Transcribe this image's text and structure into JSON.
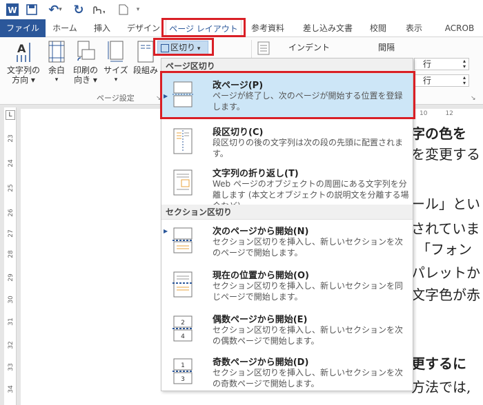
{
  "qat": {
    "app_icon": "W",
    "undo_label": "↶",
    "redo_label": "↻"
  },
  "tabs": [
    {
      "label": "ファイル"
    },
    {
      "label": "ホーム"
    },
    {
      "label": "挿入"
    },
    {
      "label": "デザイン"
    },
    {
      "label": "ページ レイアウト"
    },
    {
      "label": "参考資料"
    },
    {
      "label": "差し込み文書"
    },
    {
      "label": "校閲"
    },
    {
      "label": "表示"
    },
    {
      "label": "ACROB"
    }
  ],
  "ribbon": {
    "text_direction": {
      "line1": "文字列の",
      "line2": "方向"
    },
    "margins": {
      "line1": "余白"
    },
    "orientation": {
      "line1": "印刷の",
      "line2": "向き"
    },
    "size": {
      "line1": "サイズ"
    },
    "columns": {
      "line1": "段組み"
    },
    "breaks": {
      "label": "区切り"
    },
    "indent": {
      "label": "インデント"
    },
    "spacing": {
      "label": "間隔"
    },
    "spacing_before": {
      "unit": "行"
    },
    "spacing_after": {
      "unit": "行"
    },
    "group_page_setup": "ページ設定",
    "hruler_marks": [
      "10",
      "12"
    ]
  },
  "menu": {
    "section_page": "ページ区切り",
    "section_section": "セクション区切り",
    "items": [
      {
        "title": "改ページ(P)",
        "desc": "ページが終了し、次のページが開始する位置を登録します。"
      },
      {
        "title": "段区切り(C)",
        "desc": "段区切りの後の文字列は次の段の先頭に配置されます。"
      },
      {
        "title": "文字列の折り返し(T)",
        "desc": "Web ページのオブジェクトの周囲にある文字列を分離します (本文とオブジェクトの説明文を分離する場合など)。"
      },
      {
        "title": "次のページから開始(N)",
        "desc": "セクション区切りを挿入し、新しいセクションを次のページで開始します。"
      },
      {
        "title": "現在の位置から開始(O)",
        "desc": "セクション区切りを挿入し、新しいセクションを同じページで開始します。"
      },
      {
        "title": "偶数ページから開始(E)",
        "desc": "セクション区切りを挿入し、新しいセクションを次の偶数ページで開始します。"
      },
      {
        "title": "奇数ページから開始(D)",
        "desc": "セクション区切りを挿入し、新しいセクションを次の奇数ページで開始します。"
      }
    ]
  },
  "ruler": {
    "marker": "L",
    "numbers": [
      "23",
      "24",
      "25",
      "26",
      "27",
      "28",
      "29",
      "30",
      "31",
      "32",
      "33",
      "34"
    ]
  },
  "document": {
    "lines": [
      "字の色を",
      "を変更する",
      "ール」とい",
      "されていま",
      "「フォン",
      "パレットか",
      "文字色が赤",
      "更するに",
      "方法では,"
    ]
  },
  "colors": {
    "accent": "#2b579a",
    "highlight": "#cde6f7",
    "annotation": "#d91f26"
  }
}
